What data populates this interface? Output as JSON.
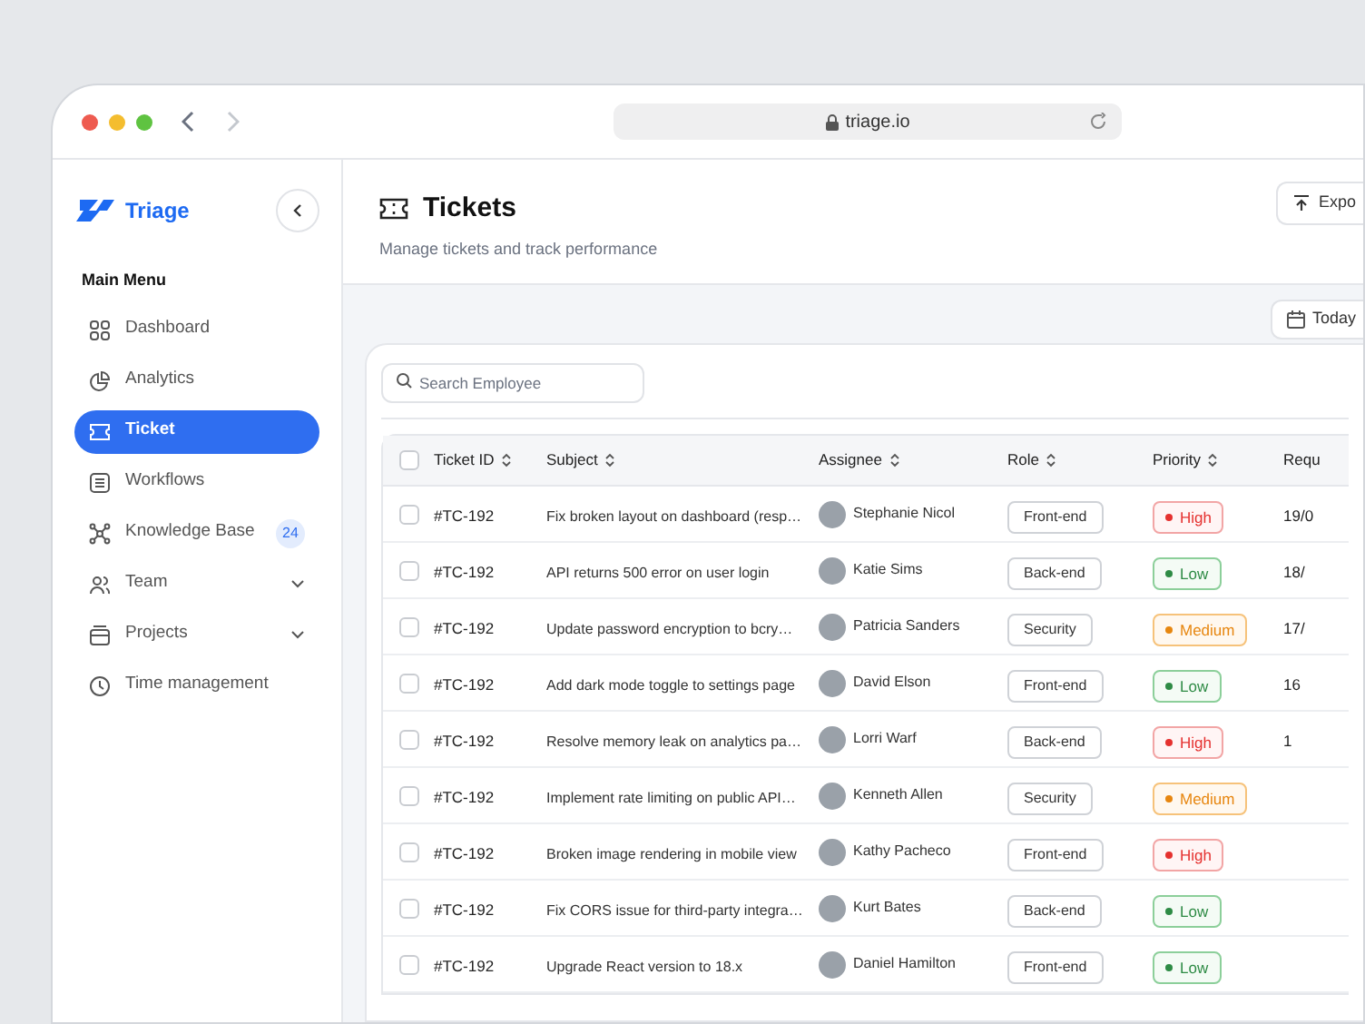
{
  "browser": {
    "url": "triage.io"
  },
  "sidebar": {
    "brand": "Triage",
    "section": "Main Menu",
    "items": [
      {
        "label": "Dashboard",
        "selected": false,
        "expandable": false
      },
      {
        "label": "Analytics",
        "selected": false,
        "expandable": false
      },
      {
        "label": "Ticket",
        "selected": true,
        "expandable": false
      },
      {
        "label": "Workflows",
        "selected": false,
        "expandable": false
      },
      {
        "label": "Knowledge Base",
        "selected": false,
        "expandable": false,
        "badge": "24"
      },
      {
        "label": "Team",
        "selected": false,
        "expandable": true
      },
      {
        "label": "Projects",
        "selected": false,
        "expandable": true
      },
      {
        "label": "Time management",
        "selected": false,
        "expandable": false
      }
    ]
  },
  "header": {
    "title": "Tickets",
    "subtitle": "Manage tickets and track performance",
    "export_button": "Expo"
  },
  "date_button": "Today",
  "search": {
    "placeholder": "Search Employee"
  },
  "table": {
    "select_all": {
      "checked": false
    },
    "columns": [
      "Ticket ID",
      "Subject",
      "Assignee",
      "Role",
      "Priority",
      "Requ"
    ],
    "rows": [
      {
        "checked": false,
        "id": "#TC-192",
        "subject": "Fix broken layout on dashboard (resp…",
        "assignee": "Stephanie Nicol",
        "role": "Front-end",
        "priority": "High",
        "kind": "high",
        "column_6": "19/0"
      },
      {
        "checked": false,
        "id": "#TC-192",
        "subject": "API returns 500 error on user login",
        "assignee": "Katie Sims",
        "role": "Back-end",
        "priority": "Low",
        "kind": "low",
        "column_6": "18/"
      },
      {
        "checked": false,
        "id": "#TC-192",
        "subject": "Update password encryption to bcry…",
        "assignee": "Patricia Sanders",
        "role": "Security",
        "priority": "Medium",
        "kind": "medium",
        "column_6": "17/"
      },
      {
        "checked": false,
        "id": "#TC-192",
        "subject": "Add dark mode toggle to settings page",
        "assignee": "David Elson",
        "role": "Front-end",
        "priority": "Low",
        "kind": "low",
        "column_6": "16"
      },
      {
        "checked": false,
        "id": "#TC-192",
        "subject": "Resolve memory leak on analytics pa…",
        "assignee": "Lorri Warf",
        "role": "Back-end",
        "priority": "High",
        "kind": "high",
        "column_6": "1"
      },
      {
        "checked": false,
        "id": "#TC-192",
        "subject": "Implement rate limiting on public API…",
        "assignee": "Kenneth Allen",
        "role": "Security",
        "priority": "Medium",
        "kind": "medium"
      },
      {
        "checked": false,
        "id": "#TC-192",
        "subject": "Broken image rendering in mobile view",
        "assignee": "Kathy Pacheco",
        "role": "Front-end",
        "priority": "High",
        "kind": "high"
      },
      {
        "checked": false,
        "id": "#TC-192",
        "subject": "Fix CORS issue for third-party integra…",
        "assignee": "Kurt Bates",
        "role": "Back-end",
        "priority": "Low",
        "kind": "low"
      },
      {
        "checked": false,
        "id": "#TC-192",
        "subject": "Upgrade React version to 18.x",
        "assignee": "Daniel Hamilton",
        "role": "Front-end",
        "priority": "Low",
        "kind": "low"
      }
    ]
  }
}
